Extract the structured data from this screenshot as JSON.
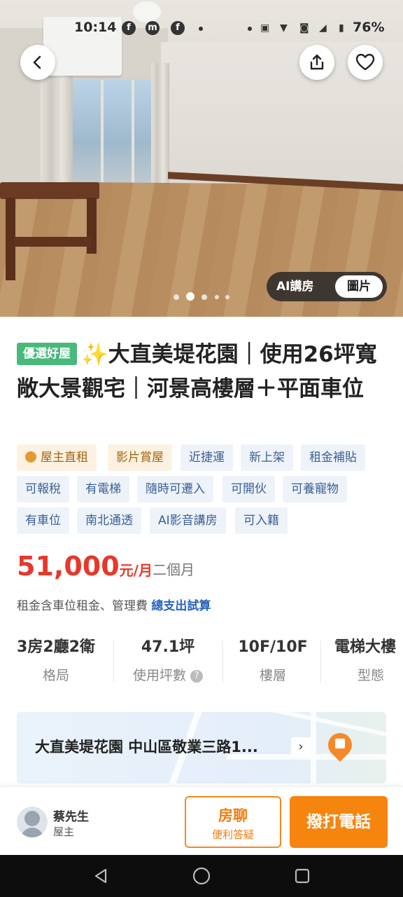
{
  "status_bar": {
    "time": "10:14",
    "battery": "76%",
    "icons": [
      "facebook-icon",
      "messenger-icon",
      "facebook-icon",
      "auto-hd-icon",
      "wifi-icon",
      "volte-icon",
      "signal-icon",
      "battery-icon"
    ]
  },
  "hero": {
    "media_options": [
      "AI講房",
      "圖片"
    ],
    "selected_option": "圖片",
    "image_count": 5,
    "current_image": 2
  },
  "listing": {
    "badge": "優選好屋",
    "title": "✨大直美堤花園｜使用26坪寬敞大景觀宅｜河景高樓層＋平面車位",
    "tags": [
      "屋主直租",
      "影片賞屋",
      "近捷運",
      "新上架",
      "租金補貼",
      "可報稅",
      "有電梯",
      "隨時可遷入",
      "可開伙",
      "可養寵物",
      "有車位",
      "南北通透",
      "AI影音講房",
      "可入籍"
    ],
    "price": {
      "amount": "51,000",
      "unit": "元/月",
      "term": "二個月",
      "note": "租金含車位租金、管理費",
      "note_link": "總支出試算"
    },
    "specs": [
      {
        "value": "3房2廳2衛",
        "label": "格局"
      },
      {
        "value": "47.1坪",
        "label": "使用坪數"
      },
      {
        "value": "10F/10F",
        "label": "樓層"
      },
      {
        "value": "電梯大樓",
        "label": "型態"
      }
    ],
    "address": "大直美堤花園 中山區敬業三路1..."
  },
  "contact": {
    "name": "蔡先生",
    "role": "屋主",
    "chat_label": "房聊",
    "chat_sub": "便利答疑",
    "call_label": "撥打電話"
  },
  "colors": {
    "accent": "#f5850f",
    "price": "#e6382b",
    "badge": "#48b97a",
    "tag_bg": "#eef3fa",
    "tag_text": "#3b5f95"
  }
}
